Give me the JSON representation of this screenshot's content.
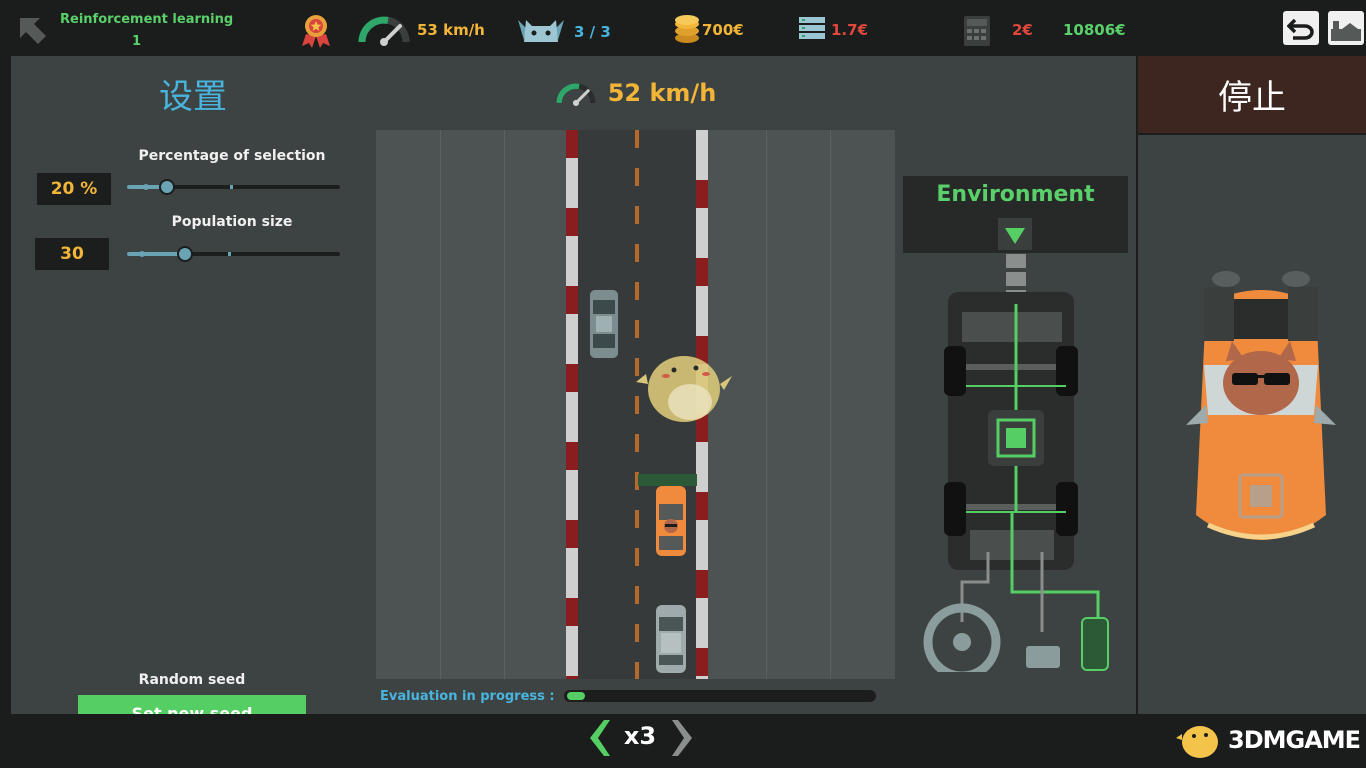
{
  "topbar": {
    "mode_title": "Reinforcement learning",
    "mode_level": "1",
    "speed": "53 km/h",
    "cats": "3 / 3",
    "coins": "700€",
    "server_cost": "1.7€",
    "calc_cost": "2€",
    "total": "10806€"
  },
  "settings": {
    "title": "设置",
    "percentage_label": "Percentage of selection",
    "percentage_value": "20 %",
    "percentage_fraction": 0.19,
    "population_label": "Population size",
    "population_value": "30",
    "population_fraction": 0.27,
    "random_seed_label": "Random seed",
    "set_seed_button": "Set new seed"
  },
  "track": {
    "speed": "52 km/h",
    "eval_label": "Evaluation in progress :",
    "eval_progress": 0.06
  },
  "environment": {
    "title": "Environment"
  },
  "controls": {
    "stop_button": "停止",
    "speed_multiplier": "x3"
  },
  "watermark": {
    "text": "3DMGAME"
  },
  "colors": {
    "accent_green": "#55cf63",
    "accent_blue": "#49b4de",
    "value_orange": "#f2b538",
    "cost_red": "#e0483e",
    "car_orange": "#f08a3c"
  }
}
